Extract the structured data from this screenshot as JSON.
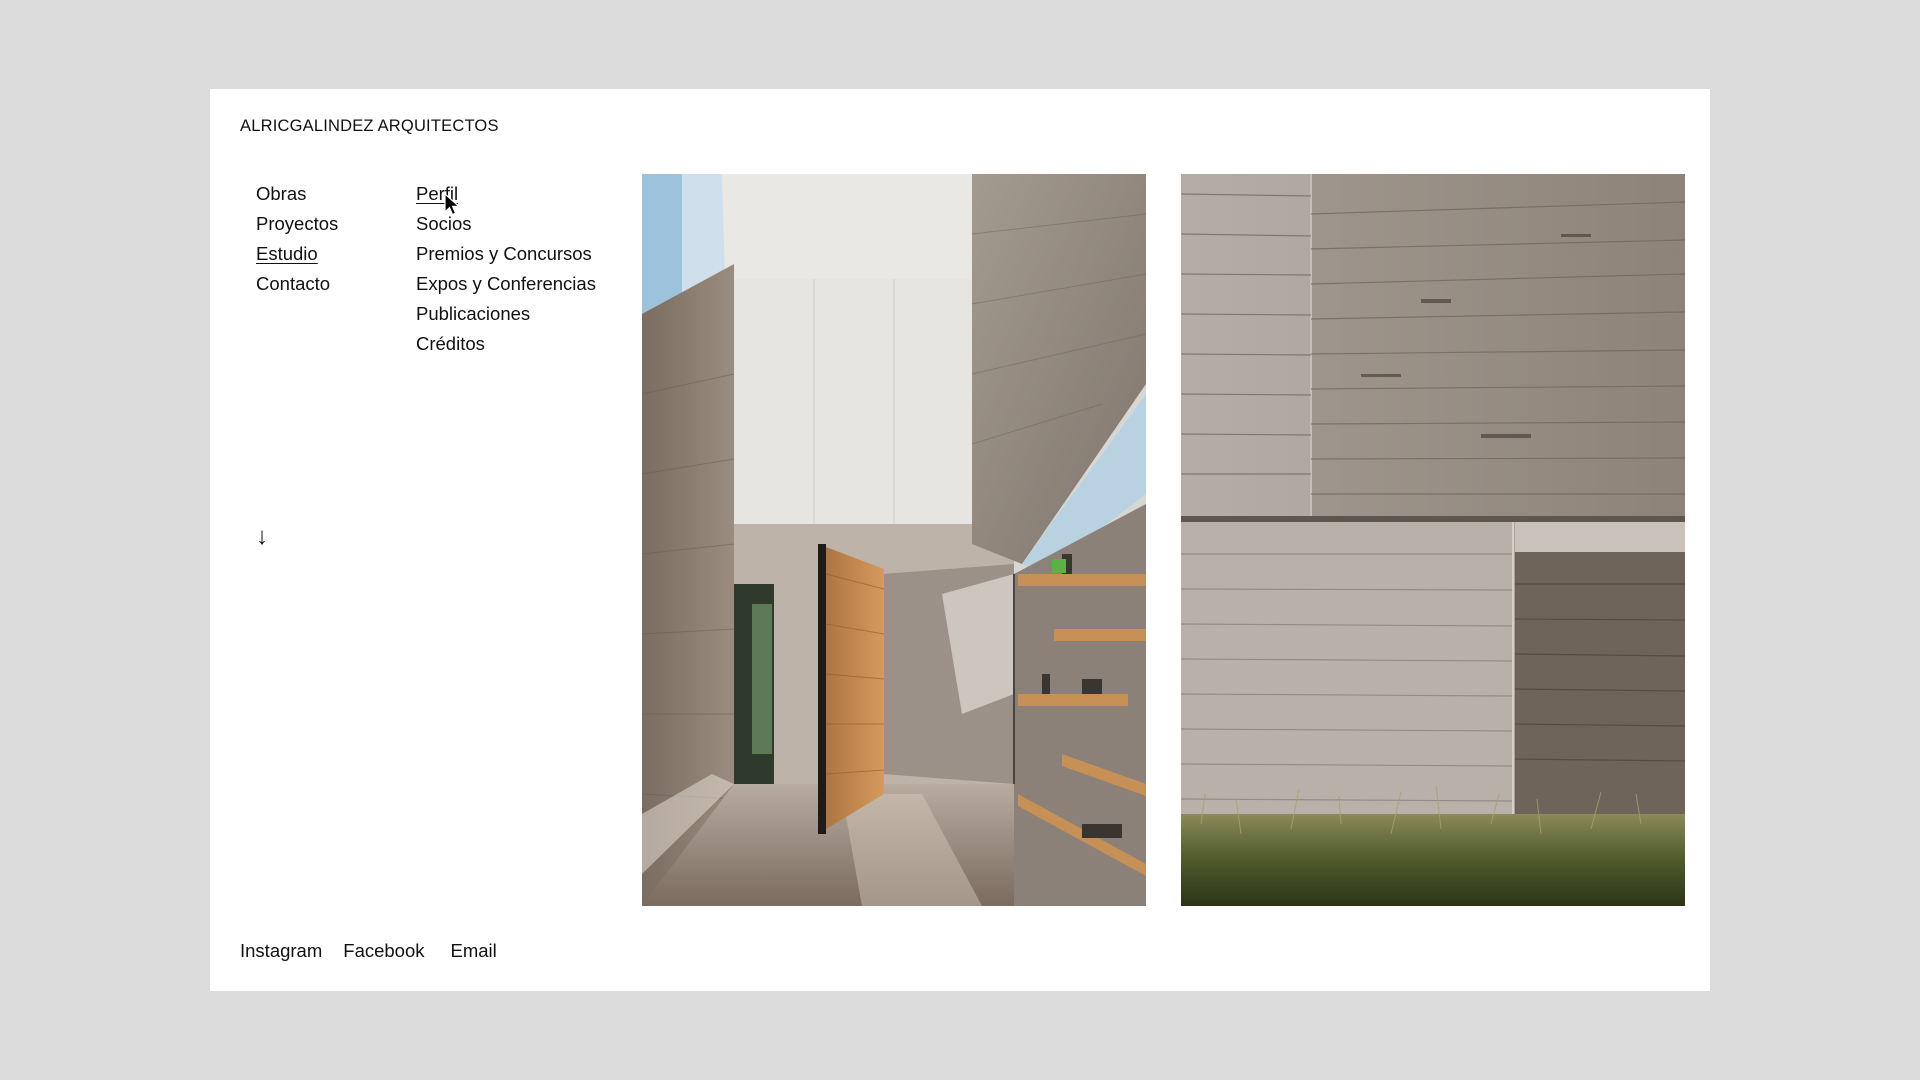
{
  "brand": {
    "name": "ALRICGALINDEZ ARQUITECTOS"
  },
  "nav": {
    "primary": [
      "Obras",
      "Proyectos",
      "Estudio",
      "Contacto"
    ],
    "secondary": [
      "Perfil",
      "Socios",
      "Premios y Concursos",
      "Expos y Conferencias",
      "Publicaciones",
      "Créditos"
    ],
    "active_primary": "Estudio",
    "active_secondary": "Perfil"
  },
  "scroll": {
    "icon": "arrow-down-icon",
    "glyph": "↓"
  },
  "gallery": {
    "images": [
      {
        "name": "interior-entrance-photo",
        "alt": "Interior with concrete walls, pivoting wood door and shelves"
      },
      {
        "name": "concrete-facade-photo",
        "alt": "Board-formed concrete facade with tall grass"
      }
    ]
  },
  "social": {
    "instagram": "Instagram",
    "facebook": "Facebook",
    "email": "Email"
  },
  "colors": {
    "background": "#dcdcdc",
    "panel": "#ffffff",
    "text": "#111111"
  }
}
